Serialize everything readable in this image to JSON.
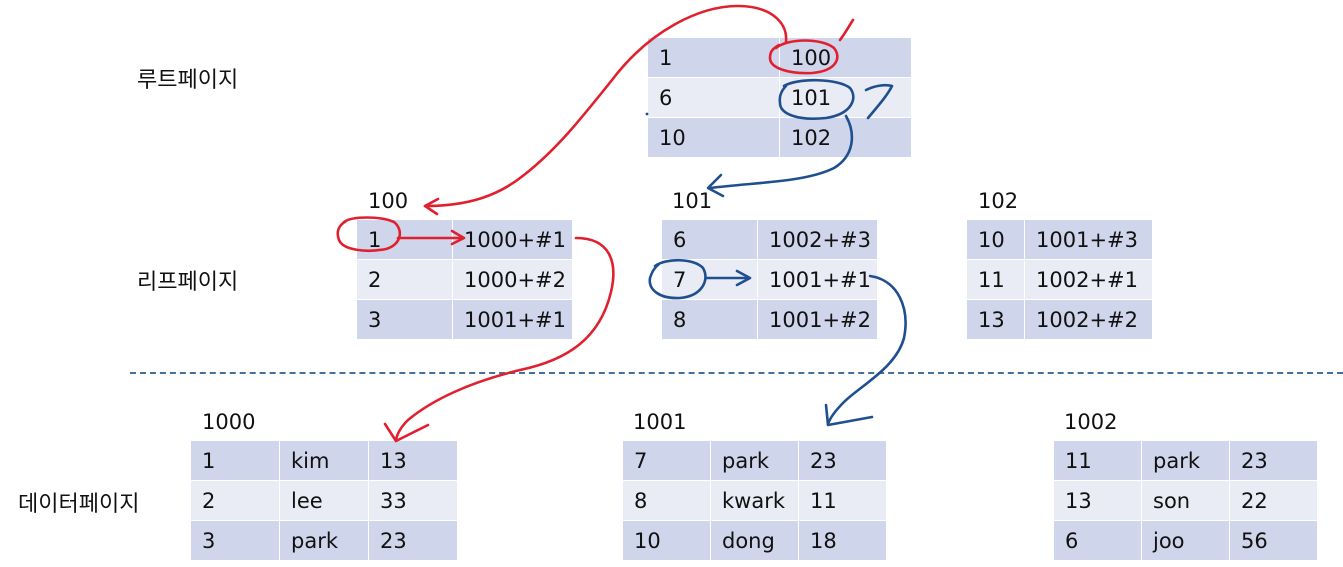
{
  "labels": {
    "root": "루트페이지",
    "leaf": "리프페이지",
    "data": "데이터페이지"
  },
  "root_page": {
    "rows": [
      [
        "1",
        "100"
      ],
      [
        "6",
        "101"
      ],
      [
        "10",
        "102"
      ]
    ]
  },
  "leaf_pages": [
    {
      "id": "100",
      "rows": [
        [
          "1",
          "1000+#1"
        ],
        [
          "2",
          "1000+#2"
        ],
        [
          "3",
          "1001+#1"
        ]
      ]
    },
    {
      "id": "101",
      "rows": [
        [
          "6",
          "1002+#3"
        ],
        [
          "7",
          "1001+#1"
        ],
        [
          "8",
          "1001+#2"
        ]
      ]
    },
    {
      "id": "102",
      "rows": [
        [
          "10",
          "1001+#3"
        ],
        [
          "11",
          "1002+#1"
        ],
        [
          "13",
          "1002+#2"
        ]
      ]
    }
  ],
  "data_pages": [
    {
      "id": "1000",
      "rows": [
        [
          "1",
          "kim",
          "13"
        ],
        [
          "2",
          "lee",
          "33"
        ],
        [
          "3",
          "park",
          "23"
        ]
      ]
    },
    {
      "id": "1001",
      "rows": [
        [
          "7",
          "park",
          "23"
        ],
        [
          "8",
          "kwark",
          "11"
        ],
        [
          "10",
          "dong",
          "18"
        ]
      ]
    },
    {
      "id": "1002",
      "rows": [
        [
          "11",
          "park",
          "23"
        ],
        [
          "13",
          "son",
          "22"
        ],
        [
          "6",
          "joo",
          "56"
        ]
      ]
    }
  ],
  "annotation": {
    "search_key": "7",
    "colors": {
      "red": "#e0202e",
      "blue": "#1f4f8f",
      "table_dark": "#cfd5ea",
      "table_light": "#e9ebf5",
      "divider": "#41719c"
    }
  }
}
